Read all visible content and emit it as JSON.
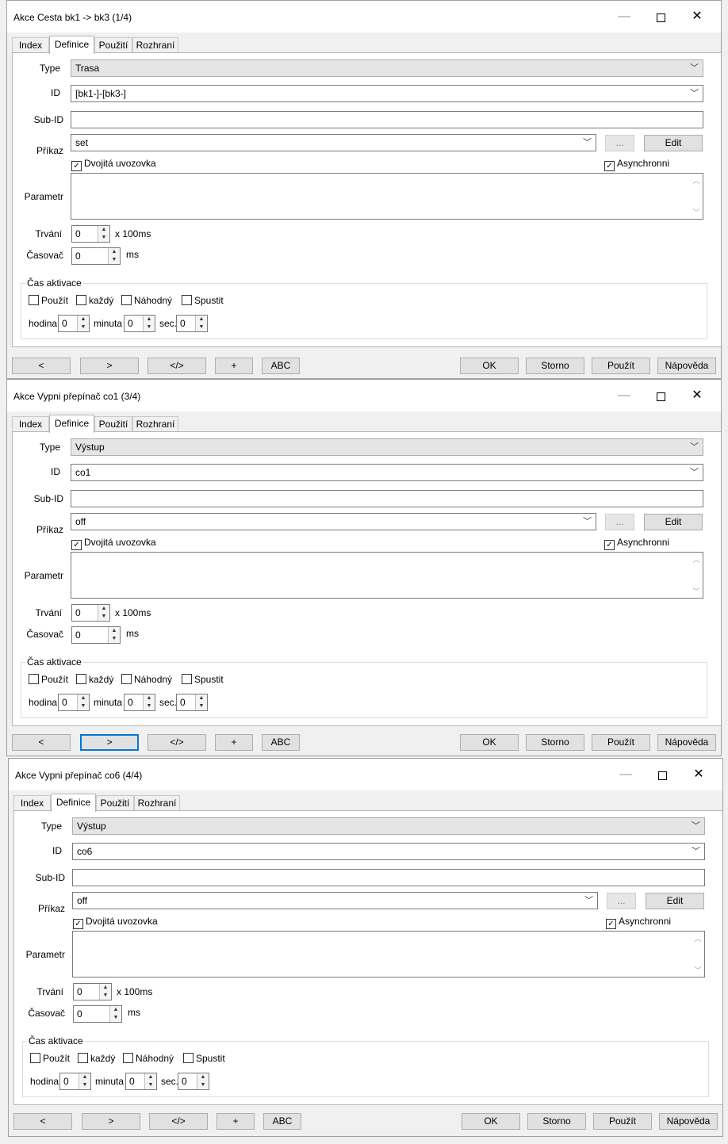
{
  "labels": {
    "type": "Type",
    "id": "ID",
    "subid": "Sub-ID",
    "prikaz": "Příkaz",
    "parametr": "Parametr",
    "trvani": "Trvání",
    "casovac": "Časovač",
    "x100ms": "x 100ms",
    "ms": "ms",
    "cas_aktivace": "Čas aktivace",
    "hodina": "hodina",
    "minuta": "minuta",
    "sec": "sec.",
    "dvojita": "Dvojitá uvozovka",
    "asynchronni": "Asynchronni",
    "pouzit_chk": "Použít",
    "kazdy": "každý",
    "nahodny": "Náhodný",
    "spustit": "Spustit",
    "dots": "...",
    "edit": "Edit"
  },
  "tabs": [
    "Index",
    "Definice",
    "Použití",
    "Rozhraní"
  ],
  "buttons": {
    "prev": "<",
    "next": ">",
    "code": "</>",
    "plus": "+",
    "abc": "ABC",
    "ok": "OK",
    "storno": "Storno",
    "pouzit": "Použít",
    "napoveda": "Nápověda"
  },
  "icons": {
    "minimize": "minimize-icon",
    "maximize": "maximize-icon",
    "close": "close-icon"
  },
  "windows": [
    {
      "title": "Akce Cesta bk1 -> bk3 (1/4)",
      "type": "Trasa",
      "id": "[bk1-]-[bk3-]",
      "subid": "",
      "prikaz": "set",
      "dvojita": true,
      "asynchronni": true,
      "parametr": "",
      "trvani": "0",
      "casovac": "0",
      "pouzit": false,
      "kazdy": false,
      "nahodny": false,
      "spustit": false,
      "hodina": "0",
      "minuta": "0",
      "sec": "0"
    },
    {
      "title": "Akce Vypni přepínač co1 (3/4)",
      "type": "Výstup",
      "id": "co1",
      "subid": "",
      "prikaz": "off",
      "dvojita": true,
      "asynchronni": true,
      "parametr": "",
      "trvani": "0",
      "casovac": "0",
      "pouzit": false,
      "kazdy": false,
      "nahodny": false,
      "spustit": false,
      "hodina": "0",
      "minuta": "0",
      "sec": "0"
    },
    {
      "title": "Akce Vypni přepínač co6 (4/4)",
      "type": "Výstup",
      "id": "co6",
      "subid": "",
      "prikaz": "off",
      "dvojita": true,
      "asynchronni": true,
      "parametr": "",
      "trvani": "0",
      "casovac": "0",
      "pouzit": false,
      "kazdy": false,
      "nahodny": false,
      "spustit": false,
      "hodina": "0",
      "minuta": "0",
      "sec": "0"
    }
  ]
}
